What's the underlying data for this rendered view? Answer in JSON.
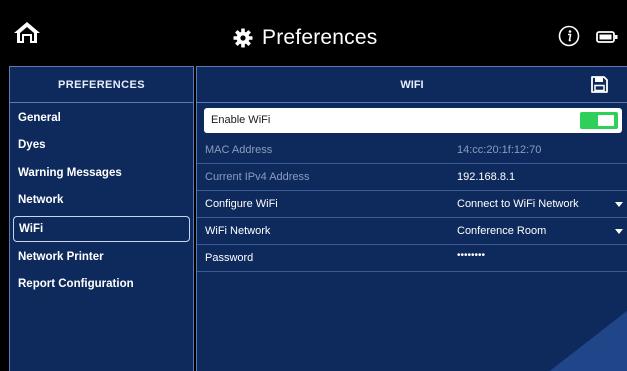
{
  "header": {
    "title": "Preferences",
    "icons": [
      "home-icon",
      "gear-icon",
      "info-icon",
      "battery-icon"
    ]
  },
  "sidebar": {
    "heading": "PREFERENCES",
    "items": [
      {
        "label": "General"
      },
      {
        "label": "Dyes"
      },
      {
        "label": "Warning Messages"
      },
      {
        "label": "Network"
      },
      {
        "label": "WiFi",
        "active": true
      },
      {
        "label": "Network Printer"
      },
      {
        "label": "Report Configuration"
      }
    ]
  },
  "main": {
    "heading": "WIFI",
    "enable_wifi": {
      "label": "Enable WiFi",
      "state": "on"
    },
    "rows": [
      {
        "label": "MAC Address",
        "value": "14:cc:20:1f:12:70"
      },
      {
        "label": "Current IPv4 Address",
        "value": "192.168.8.1"
      },
      {
        "label": "Configure WiFi",
        "value": "Connect to WiFi Network"
      },
      {
        "label": "WiFi Network",
        "value": "Conference Room"
      },
      {
        "label": "Password",
        "value": "••••••••"
      }
    ]
  },
  "colors": {
    "panel_bg": "#0e2a5c",
    "border": "#5b79b3",
    "toggle_on": "#2fcf5b"
  }
}
